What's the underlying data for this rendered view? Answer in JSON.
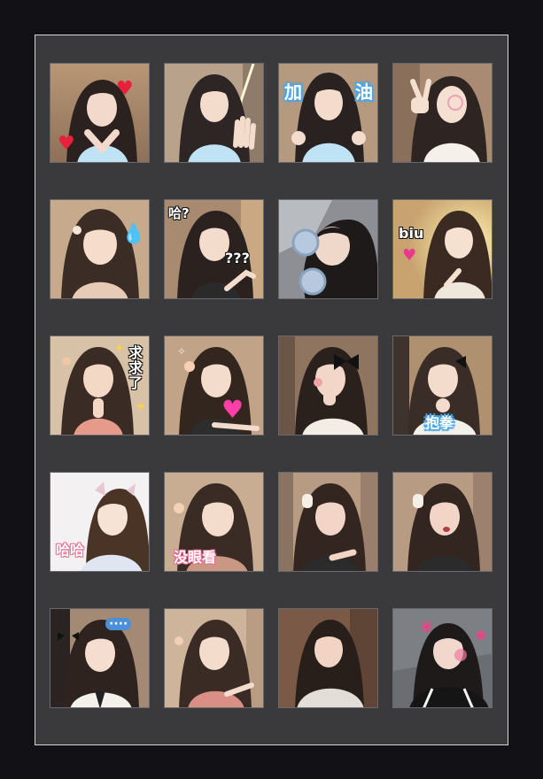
{
  "sticker_grid": {
    "stickers": [
      {
        "caption": "",
        "icon": "heart-icon"
      },
      {
        "caption": "",
        "icon": "wave-hand"
      },
      {
        "caption_left": "加",
        "caption_right": "油"
      },
      {
        "caption": "",
        "icon": "peace-sign"
      },
      {
        "caption": "",
        "icon": "sweat-drop-icon"
      },
      {
        "caption_top": "哈?",
        "caption_bottom": "???"
      },
      {
        "caption": "",
        "icon": "headphones"
      },
      {
        "caption": "biu",
        "icon": "heart-icon"
      },
      {
        "caption": "求求了"
      },
      {
        "caption": "",
        "icon": "heart-icon"
      },
      {
        "caption": "",
        "icon": "bow"
      },
      {
        "caption": "抱拳"
      },
      {
        "caption": "哈哈"
      },
      {
        "caption": "没眼看"
      },
      {
        "caption": "",
        "icon": "bow"
      },
      {
        "caption": "",
        "icon": "bow"
      },
      {
        "caption": "····"
      },
      {
        "caption": ""
      },
      {
        "caption": ""
      },
      {
        "caption": "",
        "icon": "pink-bows"
      }
    ]
  },
  "colors": {
    "page_background": "#121216",
    "frame_background": "#3a3a3d",
    "frame_border": "#d8d8d8"
  }
}
